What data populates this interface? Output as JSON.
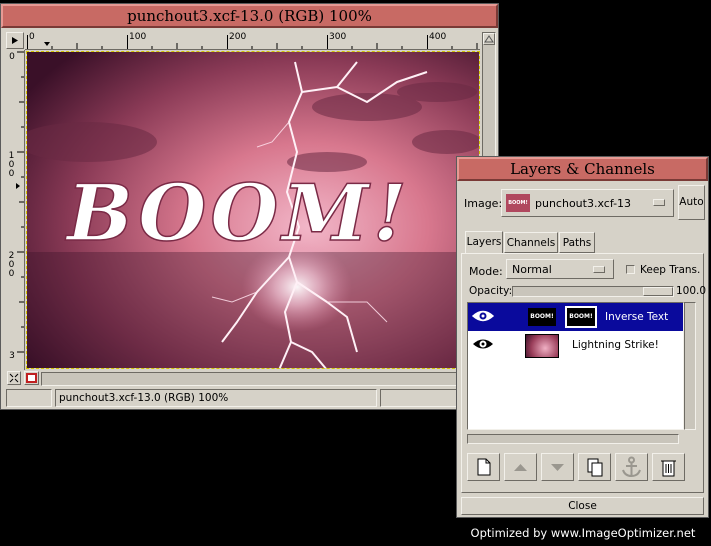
{
  "image_window": {
    "title": "punchout3.xcf-13.0 (RGB) 100%",
    "h_ruler_labels": [
      "0",
      "100",
      "200",
      "300",
      "400"
    ],
    "v_ruler_labels": [
      "0",
      "100",
      "200",
      "3"
    ],
    "canvas_text": "BOOM!",
    "status_text": "punchout3.xcf-13.0 (RGB) 100%"
  },
  "layers_window": {
    "title": "Layers & Channels",
    "image_label": "Image:",
    "image_value": "punchout3.xcf-13",
    "image_thumb_text": "BOOM!",
    "auto_label": "Auto",
    "tabs": [
      {
        "label": "Layers"
      },
      {
        "label": "Channels"
      },
      {
        "label": "Paths"
      }
    ],
    "mode_label": "Mode:",
    "mode_value": "Normal",
    "keep_trans_label": "Keep Trans.",
    "opacity_label": "Opacity:",
    "opacity_value": "100.0",
    "layers": [
      {
        "name": "Inverse Text",
        "thumb_text": "BOOM!",
        "mask_text": "BOOM!",
        "selected": true,
        "visible": true
      },
      {
        "name": "Lightning Strike!",
        "selected": false,
        "visible": true
      }
    ],
    "toolbar_icons": [
      "new-layer-icon",
      "raise-layer-icon",
      "lower-layer-icon",
      "duplicate-layer-icon",
      "anchor-layer-icon",
      "delete-layer-icon"
    ],
    "close_label": "Close"
  },
  "watermark": "Optimized by www.ImageOptimizer.net",
  "colors": {
    "titlebar": "#c86a64",
    "selection": "#0a0a9c",
    "window_bg": "#d6d2c8"
  }
}
